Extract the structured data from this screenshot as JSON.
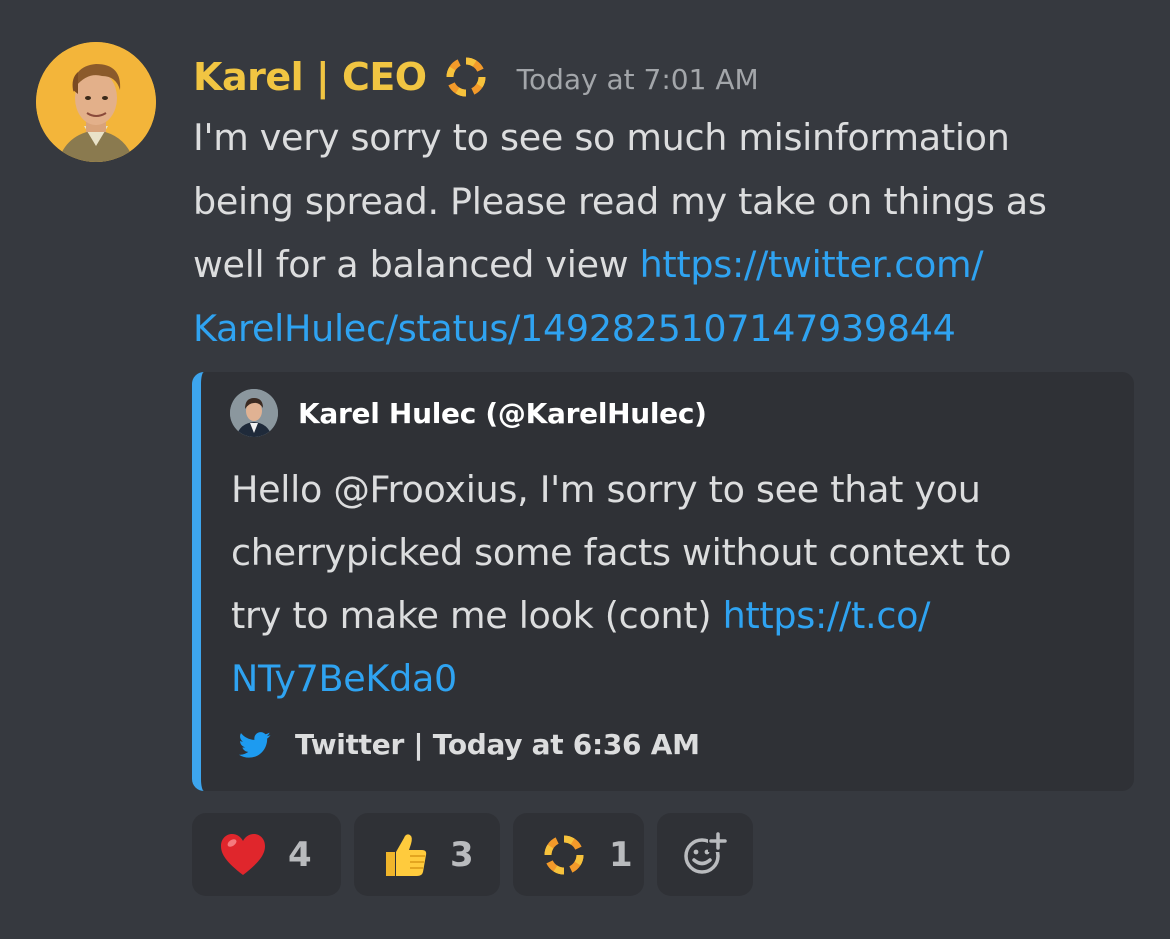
{
  "author": {
    "name": "Karel | CEO",
    "name_color": "#f1c542",
    "role_icon": "resonite-ring-icon",
    "avatar": "illustrated-man-portrait"
  },
  "timestamp": "Today at 7:01 AM",
  "message": {
    "lines": [
      "I'm very sorry to see so much misinformation",
      "being spread. Please read my take on things as",
      "well for a balanced view "
    ],
    "link_part1": "https://twitter.com/",
    "link_part2": "KarelHulec/status/1492825107147939844"
  },
  "embed": {
    "accent_color": "#3da5ee",
    "author": "Karel Hulec (@KarelHulec)",
    "description_lines": [
      "Hello @Frooxius, I'm sorry to see that you",
      "cherrypicked some facts without context to",
      "try to make me look (cont) "
    ],
    "link_part1": "https://t.co/",
    "link_part2": "NTy7BeKda0",
    "footer_icon": "twitter-bird-icon",
    "footer": "Twitter | Today at 6:36 AM"
  },
  "reactions": [
    {
      "emoji": "red-heart-icon",
      "count": "4"
    },
    {
      "emoji": "thumbs-up-icon",
      "count": "3"
    },
    {
      "emoji": "resonite-ring-icon",
      "count": "1"
    }
  ],
  "add_reaction_icon": "add-reaction-smiley-icon",
  "colors": {
    "background": "#36393f",
    "embed_background": "#2f3136",
    "link": "#2fa3f1",
    "text": "#dcddde"
  }
}
